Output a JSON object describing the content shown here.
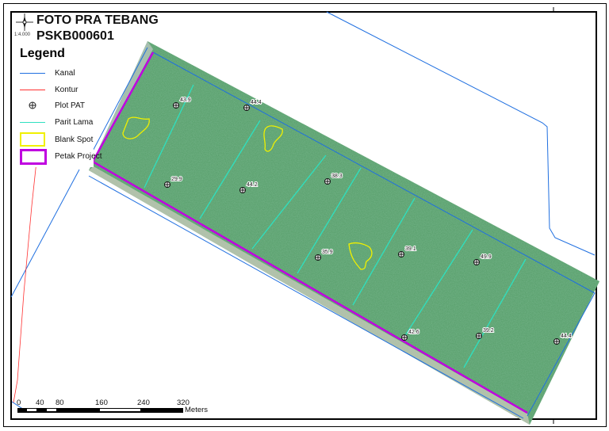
{
  "title": {
    "line1": "FOTO PRA TEBANG",
    "line2": "PSKB000601"
  },
  "scale_text": "1:4.000",
  "legend": {
    "title": "Legend",
    "items": [
      {
        "label": "Kanal",
        "symbol": "line",
        "color": "#1f6fe0"
      },
      {
        "label": "Kontur",
        "symbol": "line",
        "color": "#ff3030"
      },
      {
        "label": "Plot PAT",
        "symbol": "crosshair-circle",
        "color": "#222222"
      },
      {
        "label": "Parit Lama",
        "symbol": "line",
        "color": "#2ee0c0"
      },
      {
        "label": "Blank Spot",
        "symbol": "box",
        "color": "#f0f000"
      },
      {
        "label": "Petak Project",
        "symbol": "box",
        "color": "#c000e0"
      }
    ]
  },
  "scalebar": {
    "ticks": [
      "0",
      "40",
      "80",
      "160",
      "240",
      "320"
    ],
    "unit": "Meters"
  },
  "plots": [
    "43.9",
    "44.4",
    "29.9",
    "44.2",
    "38.3",
    "35.9",
    "39.1",
    "49.9",
    "42.6",
    "39.2",
    "44.4"
  ],
  "colors": {
    "kanal": "#1f6fe0",
    "kontur": "#ff3030",
    "parit": "#2ee0c0",
    "blank": "#f0f000",
    "petak": "#c000e0",
    "vegetation": "#4f9a63"
  }
}
